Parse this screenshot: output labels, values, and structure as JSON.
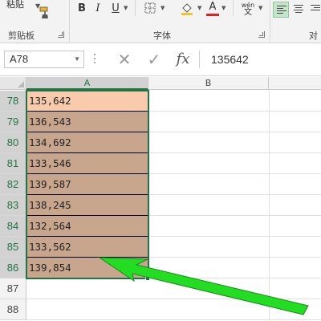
{
  "ribbon": {
    "paste_label": "粘贴",
    "clipboard_group": "剪贴板",
    "font_group": "字体",
    "align_group_partial": "对",
    "bold": "B",
    "italic": "I",
    "underline": "U",
    "font_color_glyph": "A",
    "phonetic_top": "wén",
    "phonetic_bottom": "文",
    "icons": [
      "format-painter-icon",
      "border-icon",
      "fill-color-icon",
      "font-color-icon",
      "phonetic-icon",
      "align-left-icon",
      "align-center-icon",
      "align-right-icon"
    ]
  },
  "formula_bar": {
    "name_box": "A78",
    "fx_label": "fx",
    "cancel_glyph": "✕",
    "enter_glyph": "✓",
    "value": "135642"
  },
  "sheet": {
    "columns": [
      "A",
      "B"
    ],
    "rows": [
      {
        "num": "78",
        "value": "135,642",
        "style": "active"
      },
      {
        "num": "79",
        "value": "136,543",
        "style": "brown"
      },
      {
        "num": "80",
        "value": "134,692",
        "style": "brown"
      },
      {
        "num": "81",
        "value": "133,546",
        "style": "brown"
      },
      {
        "num": "82",
        "value": "139,587",
        "style": "brown"
      },
      {
        "num": "83",
        "value": "138,245",
        "style": "brown"
      },
      {
        "num": "84",
        "value": "132,564",
        "style": "brown"
      },
      {
        "num": "85",
        "value": "133,562",
        "style": "brown"
      },
      {
        "num": "86",
        "value": "139,854",
        "style": "brown"
      },
      {
        "num": "87",
        "value": "",
        "style": "empty"
      },
      {
        "num": "88",
        "value": "",
        "style": "empty"
      }
    ]
  },
  "annotation": {
    "arrow_color": "#22dd22"
  },
  "colors": {
    "selection_green": "#217346",
    "active_cell_fill": "#f8cbad",
    "range_fill": "#c8a68e"
  }
}
